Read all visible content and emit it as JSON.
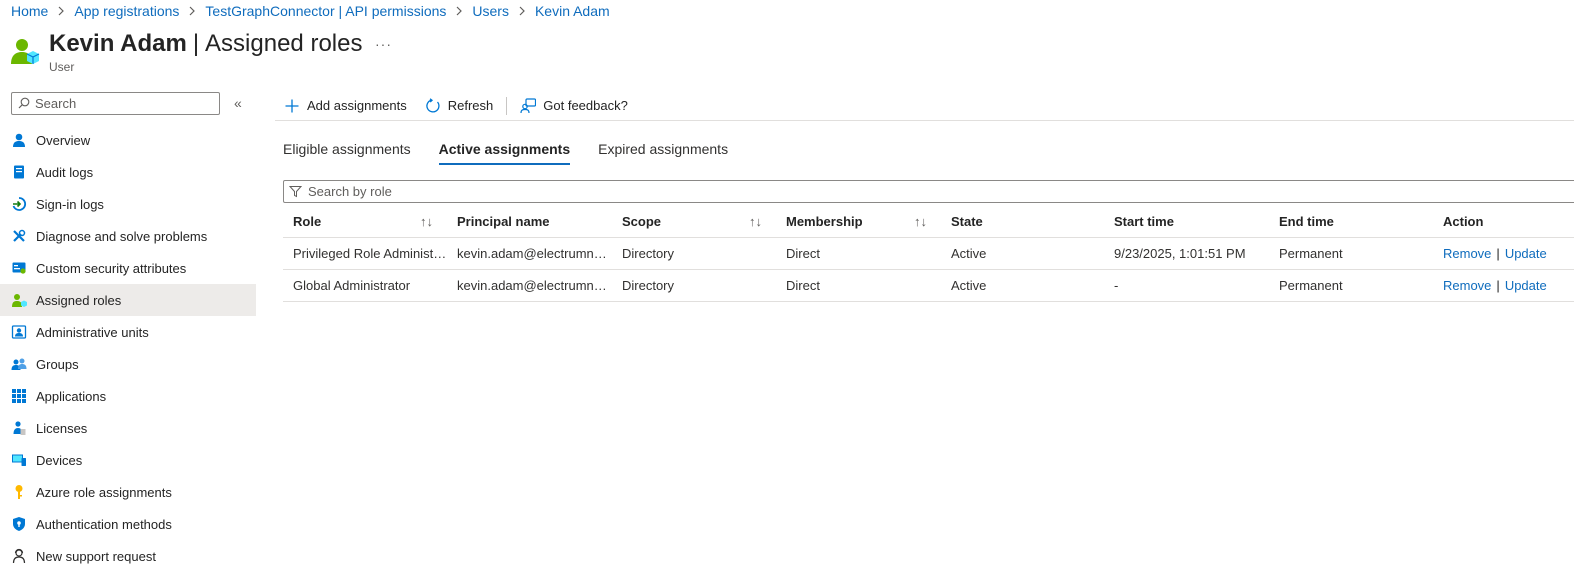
{
  "breadcrumb": {
    "items": [
      "Home",
      "App registrations",
      "TestGraphConnector | API permissions",
      "Users",
      "Kevin Adam"
    ]
  },
  "header": {
    "name": "Kevin Adam",
    "separator": "|",
    "page": "Assigned roles",
    "subtitle": "User",
    "more": "···"
  },
  "sidebar": {
    "search_placeholder": "Search",
    "collapse": "«",
    "items": [
      {
        "label": "Overview",
        "icon": "user-overview-icon"
      },
      {
        "label": "Audit logs",
        "icon": "audit-log-icon"
      },
      {
        "label": "Sign-in logs",
        "icon": "sign-in-icon"
      },
      {
        "label": "Diagnose and solve problems",
        "icon": "wrench-icon"
      },
      {
        "label": "Custom security attributes",
        "icon": "security-attributes-icon"
      },
      {
        "label": "Assigned roles",
        "icon": "assigned-roles-icon"
      },
      {
        "label": "Administrative units",
        "icon": "admin-units-icon"
      },
      {
        "label": "Groups",
        "icon": "groups-icon"
      },
      {
        "label": "Applications",
        "icon": "applications-grid-icon"
      },
      {
        "label": "Licenses",
        "icon": "licenses-icon"
      },
      {
        "label": "Devices",
        "icon": "devices-icon"
      },
      {
        "label": "Azure role assignments",
        "icon": "key-icon"
      },
      {
        "label": "Authentication methods",
        "icon": "shield-icon"
      },
      {
        "label": "New support request",
        "icon": "support-person-icon"
      }
    ]
  },
  "toolbar": {
    "add": "Add assignments",
    "refresh": "Refresh",
    "feedback": "Got feedback?"
  },
  "tabs": [
    {
      "label": "Eligible assignments",
      "active": false
    },
    {
      "label": "Active assignments",
      "active": true
    },
    {
      "label": "Expired assignments",
      "active": false
    }
  ],
  "filter": {
    "placeholder": "Search by role"
  },
  "table": {
    "headers": [
      "Role",
      "Principal name",
      "Scope",
      "Membership",
      "State",
      "Start time",
      "End time",
      "Action"
    ],
    "sort_glyph": "↑↓",
    "rows": [
      {
        "role": "Privileged Role Administrator",
        "principal": "kevin.adam@electrumnet.onmicrosoft.com",
        "scope": "Directory",
        "membership": "Direct",
        "state": "Active",
        "start": "9/23/2025, 1:01:51 PM",
        "end": "Permanent",
        "remove": "Remove",
        "sep": "|",
        "update": "Update"
      },
      {
        "role": "Global Administrator",
        "principal": "kevin.adam@electrumnet.onmicrosoft.com",
        "scope": "Directory",
        "membership": "Direct",
        "state": "Active",
        "start": "-",
        "end": "Permanent",
        "remove": "Remove",
        "sep": "|",
        "update": "Update"
      }
    ]
  },
  "colors": {
    "link": "#0f6cbd",
    "active_nav_bg": "#edebe9",
    "user_green": "#6bb700",
    "accent_blue": "#0078d4"
  }
}
